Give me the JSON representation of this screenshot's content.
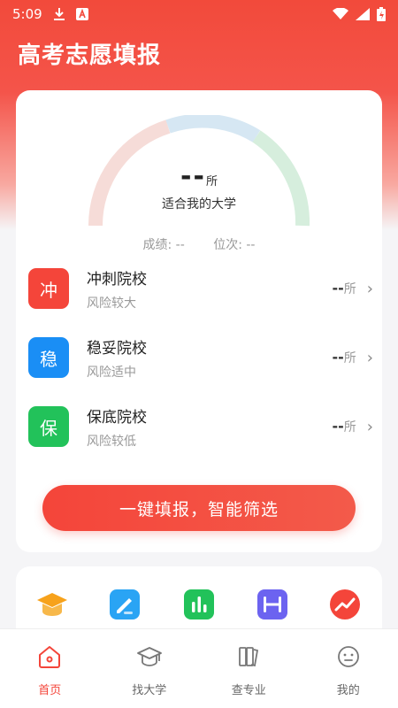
{
  "status_bar": {
    "time": "5:09"
  },
  "app_title": "高考志愿填报",
  "gauge": {
    "value": "--",
    "unit": "所",
    "subtitle": "适合我的大学"
  },
  "score": {
    "score_label": "成绩: --",
    "rank_label": "位次: --"
  },
  "tiers": [
    {
      "badge": "冲",
      "title": "冲刺院校",
      "desc": "风险较大",
      "count": "--",
      "unit": "所",
      "color": "#f4453a"
    },
    {
      "badge": "稳",
      "title": "稳妥院校",
      "desc": "风险适中",
      "count": "--",
      "unit": "所",
      "color": "#1a8ef5"
    },
    {
      "badge": "保",
      "title": "保底院校",
      "desc": "风险较低",
      "count": "--",
      "unit": "所",
      "color": "#22c25a"
    }
  ],
  "cta_label": "一键填报，智能筛选",
  "tools": [
    {
      "icon": "graduation-cap-icon",
      "color": "#f7a21b"
    },
    {
      "icon": "pen-icon",
      "color": "#2aa4f4"
    },
    {
      "icon": "bar-chart-icon",
      "color": "#22c25a"
    },
    {
      "icon": "ruler-icon",
      "color": "#6c63f0"
    },
    {
      "icon": "trend-icon",
      "color": "#f4453a"
    }
  ],
  "tabs": [
    {
      "label": "首页",
      "active": true
    },
    {
      "label": "找大学",
      "active": false
    },
    {
      "label": "查专业",
      "active": false
    },
    {
      "label": "我的",
      "active": false
    }
  ],
  "colors": {
    "accent": "#f4453a",
    "gauge_red": "#f6dcd8",
    "gauge_blue": "#d6e7f3",
    "gauge_green": "#d6eedd"
  }
}
